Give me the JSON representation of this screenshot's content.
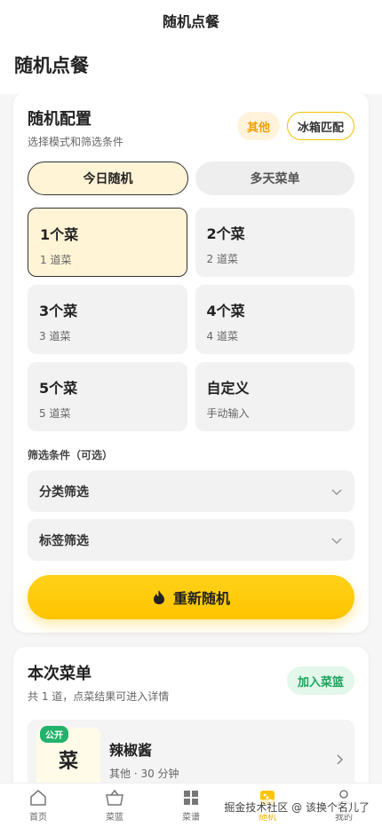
{
  "nav": {
    "title": "随机点餐"
  },
  "page": {
    "title": "随机点餐"
  },
  "config": {
    "title": "随机配置",
    "subtitle": "选择模式和筛选条件",
    "chip_other": "其他",
    "chip_fridge": "冰箱匹配",
    "modes": [
      {
        "label": "今日随机",
        "active": true
      },
      {
        "label": "多天菜单",
        "active": false
      }
    ],
    "options": [
      {
        "title": "1个菜",
        "sub": "1 道菜",
        "active": true
      },
      {
        "title": "2个菜",
        "sub": "2 道菜",
        "active": false
      },
      {
        "title": "3个菜",
        "sub": "3 道菜",
        "active": false
      },
      {
        "title": "4个菜",
        "sub": "4 道菜",
        "active": false
      },
      {
        "title": "5个菜",
        "sub": "5 道菜",
        "active": false
      },
      {
        "title": "自定义",
        "sub": "手动输入",
        "active": false
      }
    ],
    "filter_label": "筛选条件（可选）",
    "filter_category": "分类筛选",
    "filter_tag": "标签筛选",
    "reshuffle": "重新随机"
  },
  "menu": {
    "title": "本次菜单",
    "subtitle": "共 1 道，点菜结果可进入详情",
    "add_basket": "加入菜篮",
    "dish": {
      "badge": "公开",
      "thumb_text": "菜",
      "name": "辣椒酱",
      "meta": "其他 · 30 分钟"
    }
  },
  "tabs": [
    {
      "label": "首页",
      "icon": "home-icon"
    },
    {
      "label": "菜篮",
      "icon": "basket-icon"
    },
    {
      "label": "菜谱",
      "icon": "recipe-icon"
    },
    {
      "label": "随机",
      "icon": "dice-icon",
      "active": true
    },
    {
      "label": "我的",
      "icon": "user-icon"
    }
  ],
  "watermark": "掘金技术社区 @ 该换个名儿了",
  "colors": {
    "accent": "#ffc400",
    "green": "#1aa45b"
  }
}
